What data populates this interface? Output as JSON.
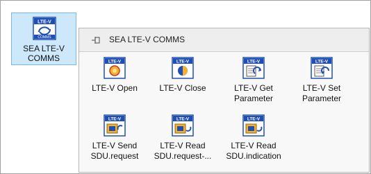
{
  "palette": {
    "selected_item": {
      "label": "SEA LTE-V\nCOMMS",
      "icon_text": "LTE-V",
      "icon_sub": "COMMS",
      "icon": "lte-v-comms-icon"
    }
  },
  "subpalette": {
    "title": "SEA LTE-V COMMS",
    "items": [
      {
        "label": "LTE-V Open",
        "icon": "lte-v-open-icon",
        "icon_text": "LTE-V"
      },
      {
        "label": "LTE-V Close",
        "icon": "lte-v-close-icon",
        "icon_text": "LTE-V"
      },
      {
        "label": "LTE-V Get\nParameter",
        "icon": "lte-v-get-parameter-icon",
        "icon_text": "LTE-V"
      },
      {
        "label": "LTE-V Set\nParameter",
        "icon": "lte-v-set-parameter-icon",
        "icon_text": "LTE-V"
      },
      {
        "label": "LTE-V Send\nSDU.request",
        "icon": "lte-v-send-sdu-icon",
        "icon_text": "LTE-V"
      },
      {
        "label": "LTE-V Read\nSDU.request-...",
        "icon": "lte-v-read-sdu-request-icon",
        "icon_text": "LTE-V"
      },
      {
        "label": "LTE-V Read\nSDU.indication",
        "icon": "lte-v-read-sdu-indication-icon",
        "icon_text": "LTE-V"
      }
    ]
  },
  "colors": {
    "icon_blue": "#1f4fb5",
    "selection": "#cde8fb",
    "selection_border": "#7ab7e6",
    "gold": "#f2b12e"
  }
}
